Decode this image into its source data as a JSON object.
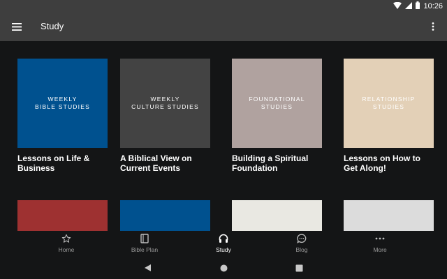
{
  "status_bar": {
    "time": "10:26",
    "icons": [
      "wifi-icon",
      "signal-icon",
      "battery-icon"
    ]
  },
  "app_bar": {
    "title": "Study",
    "menu_icon": "hamburger-menu-icon",
    "overflow_icon": "more-vert-icon"
  },
  "cards": [
    {
      "tile_text": "WEEKLY\nBIBLE STUDIES",
      "tile_color": "#00518f",
      "title": "Lessons on Life & Business"
    },
    {
      "tile_text": "WEEKLY\nCULTURE STUDIES",
      "tile_color": "#434343",
      "title": "A Biblical View on Current Events"
    },
    {
      "tile_text": "FOUNDATIONAL\nSTUDIES",
      "tile_color": "#b0a29f",
      "title": "Building a Spiritual Foundation"
    },
    {
      "tile_text": "RELATIONSHIP\nSTUDIES",
      "tile_color": "#e3d0b7",
      "title": "Lessons on How to Get Along!"
    }
  ],
  "row2_colors": [
    "#9e3131",
    "#00518f",
    "#e9e8e2",
    "#dcdcdc"
  ],
  "bottom_nav": {
    "items": [
      {
        "label": "Home",
        "icon": "star-icon",
        "active": false
      },
      {
        "label": "Bible Plan",
        "icon": "book-icon",
        "active": false
      },
      {
        "label": "Study",
        "icon": "headphones-icon",
        "active": true
      },
      {
        "label": "Blog",
        "icon": "chat-bubble-icon",
        "active": false
      },
      {
        "label": "More",
        "icon": "more-horiz-icon",
        "active": false
      }
    ]
  },
  "system_nav": [
    "back-icon",
    "home-icon",
    "recents-icon"
  ],
  "colors": {
    "bar_bg": "#3e3e3e",
    "page_bg": "#141516",
    "inactive_label": "#9a9a9a"
  }
}
